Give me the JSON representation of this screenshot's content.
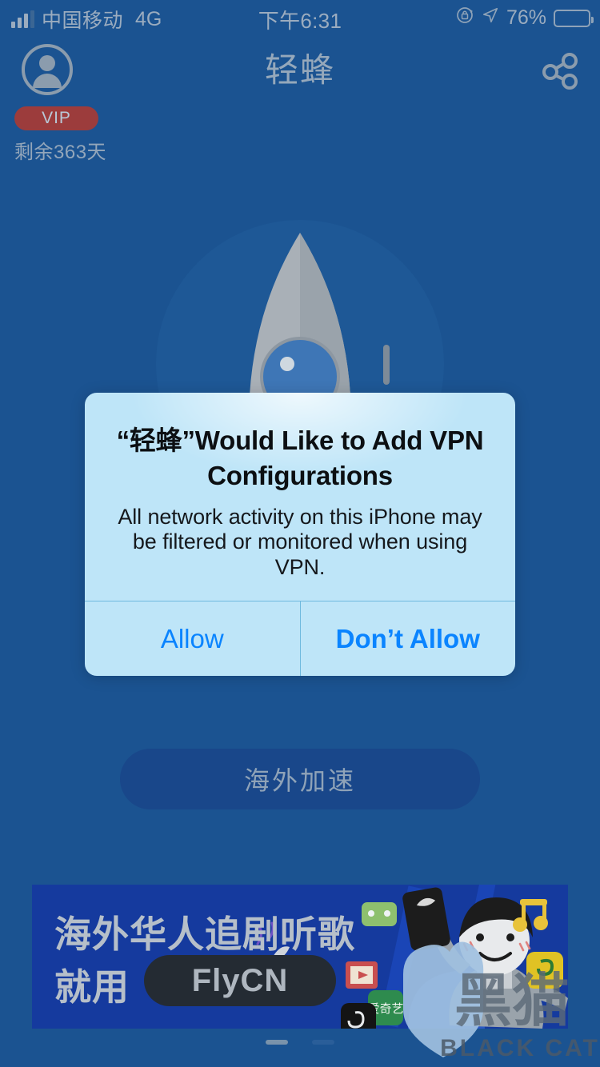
{
  "status_bar": {
    "carrier": "中国移动",
    "network": "4G",
    "time": "下午6:31",
    "battery_percent": "76%",
    "battery_level": 76,
    "icons": [
      "signal-bars-icon",
      "rotation-lock-icon",
      "location-arrow-icon",
      "battery-icon"
    ]
  },
  "header": {
    "app_title": "轻蜂",
    "share_icon": "share-icon"
  },
  "account": {
    "avatar_icon": "avatar-icon",
    "vip_badge": "VIP",
    "remaining": "剩余363天"
  },
  "hero": {
    "illustration": "rocket-icon"
  },
  "accelerate": {
    "label": "海外加速"
  },
  "promo": {
    "line1": "海外华人追剧听歌",
    "line2": "就用",
    "brand": "FlyCN"
  },
  "page_dots": {
    "count": 2,
    "active_index": 0
  },
  "watermark": {
    "chinese": "黑猫",
    "english": "BLACK CAT"
  },
  "alert": {
    "title": "“轻蜂”Would Like to Add VPN Configurations",
    "message": "All network activity on this iPhone may be filtered or monitored when using VPN.",
    "allow_label": "Allow",
    "deny_label": "Don’t Allow"
  },
  "colors": {
    "background": "#1b5391",
    "accelerate_button": "#19478a",
    "vip_badge": "#9c3c3c",
    "promo_background": "#153a9e",
    "alert_background": "#bee5f8",
    "alert_action_text": "#0a84ff",
    "muted_text": "#95a8bb"
  }
}
